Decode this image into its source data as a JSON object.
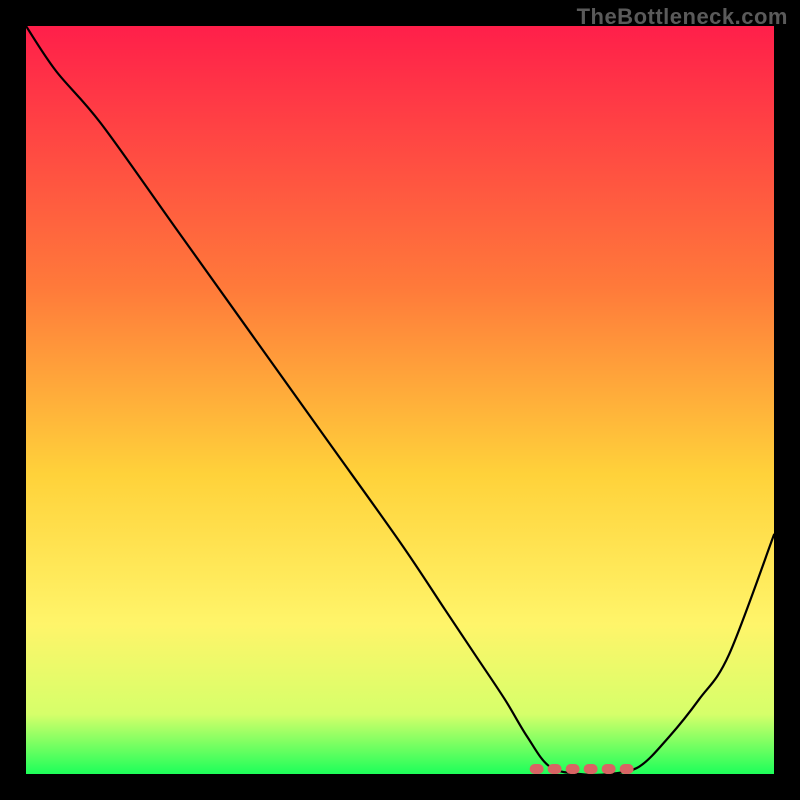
{
  "watermark": "TheBottleneck.com",
  "colors": {
    "frame": "#000000",
    "gradient_top": "#ff1f4a",
    "gradient_mid_upper": "#ff7a3a",
    "gradient_mid": "#ffd23a",
    "gradient_mid_lower": "#fff56a",
    "gradient_lower": "#d6ff6a",
    "gradient_bottom": "#1dff5a",
    "curve": "#000000",
    "marker": "#d86464"
  },
  "chart_data": {
    "type": "line",
    "title": "",
    "xlabel": "",
    "ylabel": "",
    "xlim": [
      0,
      100
    ],
    "ylim": [
      0,
      100
    ],
    "series": [
      {
        "name": "bottleneck-curve",
        "x": [
          0,
          4,
          10,
          20,
          30,
          40,
          50,
          56,
          60,
          64,
          67,
          70,
          74,
          78,
          82,
          86,
          90,
          94,
          100
        ],
        "y": [
          100,
          94,
          87,
          73,
          59,
          45,
          31,
          22,
          16,
          10,
          5,
          1,
          0,
          0,
          1,
          5,
          10,
          16,
          32
        ]
      }
    ],
    "flat_region": {
      "x_start": 68,
      "x_end": 82,
      "y": 0
    }
  }
}
